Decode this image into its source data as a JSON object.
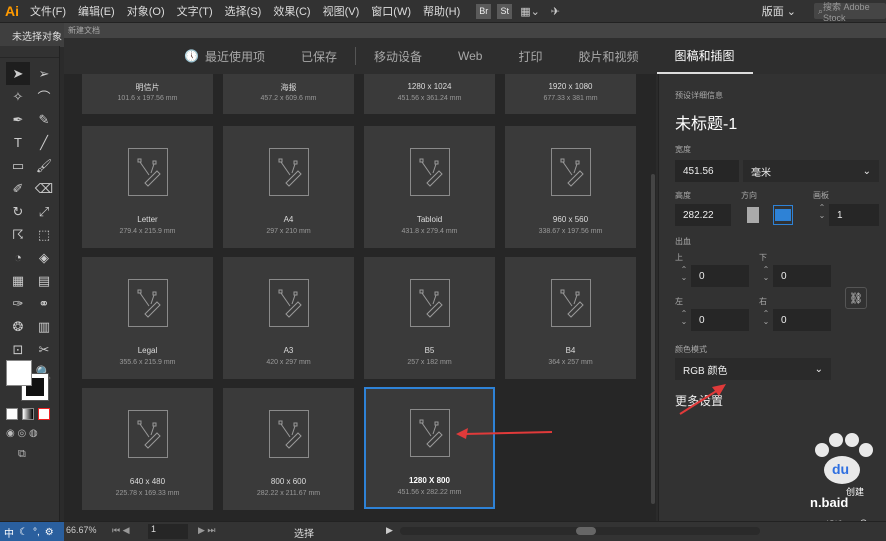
{
  "app": {
    "logo": "Ai"
  },
  "menu": [
    "文件(F)",
    "编辑(E)",
    "对象(O)",
    "文字(T)",
    "选择(S)",
    "效果(C)",
    "视图(V)",
    "窗口(W)",
    "帮助(H)"
  ],
  "menu_right": {
    "br": "Br",
    "st": "St",
    "workspace": "版面",
    "search_placeholder": "搜索 Adobe Stock"
  },
  "control": {
    "no_selection": "未选择对象",
    "doc_title": "新建文档"
  },
  "tabs": [
    {
      "label": "最近使用项",
      "icon": "clock-icon"
    },
    {
      "label": "已保存"
    },
    {
      "label": "移动设备"
    },
    {
      "label": "Web"
    },
    {
      "label": "打印"
    },
    {
      "label": "胶片和视频"
    },
    {
      "label": "图稿和插图",
      "active": true
    }
  ],
  "presets_top": [
    {
      "name": "明信片",
      "size": "101.6 x 197.56 mm"
    },
    {
      "name": "海报",
      "size": "457.2 x 609.6 mm"
    },
    {
      "name": "1280 x 1024",
      "size": "451.56 x 361.24 mm"
    },
    {
      "name": "1920 x 1080",
      "size": "677.33 x 381 mm"
    }
  ],
  "presets": [
    {
      "name": "Letter",
      "size": "279.4 x 215.9 mm"
    },
    {
      "name": "A4",
      "size": "297 x 210 mm"
    },
    {
      "name": "Tabloid",
      "size": "431.8 x 279.4 mm"
    },
    {
      "name": "960 x 560",
      "size": "338.67 x 197.56 mm"
    },
    {
      "name": "Legal",
      "size": "355.6 x 215.9 mm"
    },
    {
      "name": "A3",
      "size": "420 x 297 mm"
    },
    {
      "name": "B5",
      "size": "257 x 182 mm"
    },
    {
      "name": "B4",
      "size": "364 x 257 mm"
    },
    {
      "name": "640 x 480",
      "size": "225.78 x 169.33 mm"
    },
    {
      "name": "800 x 600",
      "size": "282.22 x 211.67 mm"
    },
    {
      "name": "1280 X 800",
      "size": "451.56 x 282.22 mm",
      "selected": true
    }
  ],
  "details": {
    "heading": "预设详细信息",
    "title": "未标题-1",
    "width_label": "宽度",
    "width_value": "451.56",
    "unit": "毫米",
    "height_label": "高度",
    "height_value": "282.22",
    "orientation_label": "方向",
    "artboards_label": "画板",
    "artboards_value": "1",
    "bleed_label": "出血",
    "top_label": "上",
    "bottom_label": "下",
    "left_label": "左",
    "right_label": "右",
    "bleed_top": "0",
    "bleed_bottom": "0",
    "bleed_left": "0",
    "bleed_right": "0",
    "color_mode_label": "颜色模式",
    "color_mode_value": "RGB 颜色",
    "more_settings": "更多设置"
  },
  "status": {
    "ime": "中",
    "zoom": "66.67%",
    "page": "1",
    "tool": "选择"
  },
  "watermark": {
    "text1": "创建",
    "text2": "n.baid",
    "text3": "Open",
    "text4": "设选"
  },
  "colors": {
    "accent": "#2e82d6",
    "arrow": "#e03a3a",
    "logo": "#ff9a00"
  }
}
